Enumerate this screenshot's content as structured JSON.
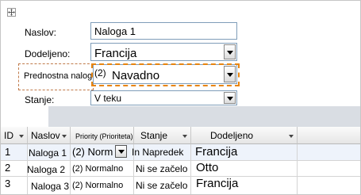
{
  "form": {
    "title_label": "Naslov:",
    "title_value": "Naloga 1",
    "assigned_label": "Dodeljeno:",
    "assigned_value": "Francija",
    "priority_label": "Prednostna naloga",
    "priority_value_code": "(2)",
    "priority_value": "Navadno",
    "status_label": "Stanje:",
    "status_value": "V teku"
  },
  "grid": {
    "columns": [
      "ID",
      "Naslov",
      "Priority (Prioriteta)",
      "Stanje",
      "Dodeljeno"
    ],
    "rows": [
      {
        "id": "1",
        "title": "Naloga 1",
        "priority": "(2) Norm",
        "status": "In  Napredek",
        "assigned": "Francija"
      },
      {
        "id": "2",
        "title": "Naloga 2",
        "priority": "(2) Normalno",
        "status": "Ni se začelo",
        "assigned": "Otto"
      },
      {
        "id": "3",
        "title": "Naloga 3",
        "priority": "(2) Normalno",
        "status": "Ni se začelo",
        "assigned": "Francija"
      }
    ]
  },
  "icons": {
    "move_handle": "move-handle-icon",
    "dropdown": "chevron-down-icon"
  }
}
